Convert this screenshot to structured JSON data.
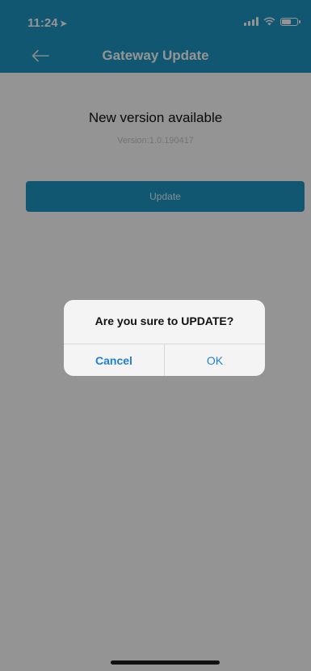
{
  "status_bar": {
    "time": "11:24",
    "location_icon": "location-arrow-icon",
    "icons": [
      "signal-icon",
      "wifi-icon",
      "battery-icon"
    ]
  },
  "nav_bar": {
    "back_icon": "back-arrow-icon",
    "title": "Gateway Update"
  },
  "main": {
    "headline": "New version available",
    "version_text": "Version:1.0.190417",
    "update_label": "Update"
  },
  "alert": {
    "title": "Are you sure to UPDATE?",
    "cancel_label": "Cancel",
    "ok_label": "OK"
  },
  "colors": {
    "accent": "#1e96c4",
    "alert_button": "#1e7fd9",
    "background": "#ffffff"
  }
}
